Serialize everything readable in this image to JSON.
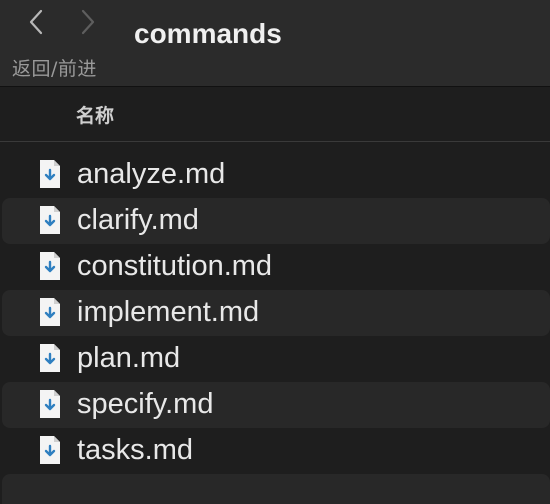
{
  "toolbar": {
    "nav_caption": "返回/前进",
    "title": "commands"
  },
  "columns": {
    "name": "名称"
  },
  "icons": {
    "back": "chevron-left-icon",
    "forward": "chevron-right-icon",
    "file": "markdown-file-icon"
  },
  "colors": {
    "icon_accent": "#2f7fc0",
    "row_alt": "#282828",
    "background": "#1e1e1e"
  },
  "files": [
    {
      "name": "analyze.md"
    },
    {
      "name": "clarify.md"
    },
    {
      "name": "constitution.md"
    },
    {
      "name": "implement.md"
    },
    {
      "name": "plan.md"
    },
    {
      "name": "specify.md"
    },
    {
      "name": "tasks.md"
    }
  ]
}
